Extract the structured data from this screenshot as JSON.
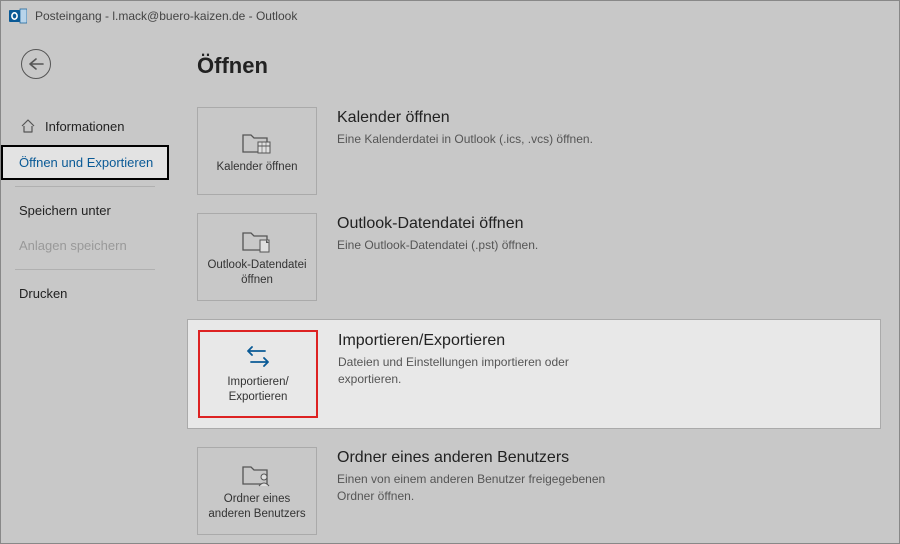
{
  "window": {
    "title": "Posteingang - l.mack@buero-kaizen.de  -  Outlook"
  },
  "sidebar": {
    "items": [
      {
        "label": "Informationen"
      },
      {
        "label": "Öffnen und Exportieren"
      },
      {
        "label": "Speichern unter"
      },
      {
        "label": "Anlagen speichern"
      },
      {
        "label": "Drucken"
      }
    ]
  },
  "page": {
    "title": "Öffnen",
    "options": [
      {
        "tile_label": "Kalender öffnen",
        "title": "Kalender öffnen",
        "desc": "Eine Kalenderdatei in Outlook (.ics, .vcs) öffnen."
      },
      {
        "tile_label": "Outlook-Datendatei öffnen",
        "title": "Outlook-Datendatei öffnen",
        "desc": "Eine Outlook-Datendatei (.pst) öffnen."
      },
      {
        "tile_label": "Importieren/\nExportieren",
        "title": "Importieren/Exportieren",
        "desc": "Dateien und Einstellungen importieren oder exportieren."
      },
      {
        "tile_label": "Ordner eines anderen Benutzers",
        "title": "Ordner eines anderen Benutzers",
        "desc": "Einen von einem anderen Benutzer freigegebenen Ordner öffnen."
      }
    ]
  }
}
